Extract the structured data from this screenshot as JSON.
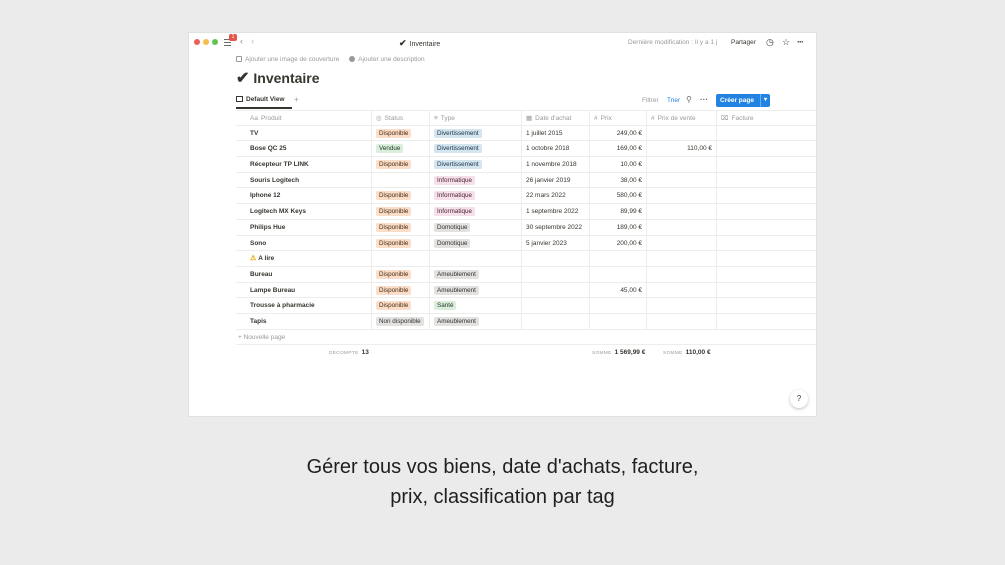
{
  "titlebar": {
    "notif_count": "1",
    "title": "Inventaire",
    "last_modified": "Dernière modification : Il y a 1 j",
    "share": "Partager"
  },
  "page": {
    "add_cover": "Ajouter une image de couverture",
    "add_description": "Ajouter une description",
    "title": "Inventaire"
  },
  "viewbar": {
    "view_name": "Default View",
    "filter": "Filtrer",
    "sort": "Trier",
    "create": "Créer page"
  },
  "columns": {
    "product": "Produit",
    "status": "Status",
    "type": "Type",
    "date": "Date d'achat",
    "price": "Prix",
    "sale_price": "Prix de vente",
    "invoice": "Facture"
  },
  "rows": [
    {
      "product": "TV",
      "status": "Disponible",
      "type": "Divertissement",
      "date": "1 juillet 2015",
      "price": "249,00 €",
      "sale": ""
    },
    {
      "product": "Bose QC 25",
      "status": "Vendue",
      "type": "Divertissement",
      "date": "1 octobre 2018",
      "price": "169,00 €",
      "sale": "110,00 €"
    },
    {
      "product": "Récepteur TP LINK",
      "status": "Disponible",
      "type": "Divertissement",
      "date": "1 novembre 2018",
      "price": "10,00 €",
      "sale": ""
    },
    {
      "product": "Souris Logitech",
      "status": "",
      "type": "Informatique",
      "date": "26 janvier 2019",
      "price": "38,00 €",
      "sale": ""
    },
    {
      "product": "Iphone 12",
      "status": "Disponible",
      "type": "Informatique",
      "date": "22 mars 2022",
      "price": "580,00 €",
      "sale": ""
    },
    {
      "product": "Logitech MX Keys",
      "status": "Disponible",
      "type": "Informatique",
      "date": "1 septembre 2022",
      "price": "89,99 €",
      "sale": ""
    },
    {
      "product": "Philips Hue",
      "status": "Disponible",
      "type": "Domotique",
      "date": "30 septembre 2022",
      "price": "189,00 €",
      "sale": ""
    },
    {
      "product": "Sono",
      "status": "Disponible",
      "type": "Domotique",
      "date": "5 janvier 2023",
      "price": "200,00 €",
      "sale": ""
    },
    {
      "product": "A lire",
      "status": "",
      "type": "",
      "date": "",
      "price": "",
      "sale": "",
      "icon": "warning-icon"
    },
    {
      "product": "Bureau",
      "status": "Disponible",
      "type": "Ameublement",
      "date": "",
      "price": "",
      "sale": ""
    },
    {
      "product": "Lampe Bureau",
      "status": "Disponible",
      "type": "Ameublement",
      "date": "",
      "price": "45,00 €",
      "sale": ""
    },
    {
      "product": "Trousse à pharmacie",
      "status": "Disponible",
      "type": "Santé",
      "date": "",
      "price": "",
      "sale": ""
    },
    {
      "product": "Tapis",
      "status": "Non disponible",
      "type": "Ameublement",
      "date": "",
      "price": "",
      "sale": ""
    }
  ],
  "new_page": "Nouvelle page",
  "calc": {
    "count_label": "DÉCOMPTE",
    "count_value": "13",
    "sum_label": "SOMME",
    "sum_price": "1 569,99 €",
    "sum_label2": "SOMME",
    "sum_sale": "110,00 €"
  },
  "help": "?",
  "caption": {
    "line1": "Gérer tous vos biens, date d'achats, facture,",
    "line2": "prix, classification par tag"
  },
  "colors": {
    "accent": "#2383e2",
    "disponible": "#fadec9",
    "vendue": "#dbeddb",
    "divertissement": "#d3e5ef",
    "informatique": "#f5e0e9"
  }
}
